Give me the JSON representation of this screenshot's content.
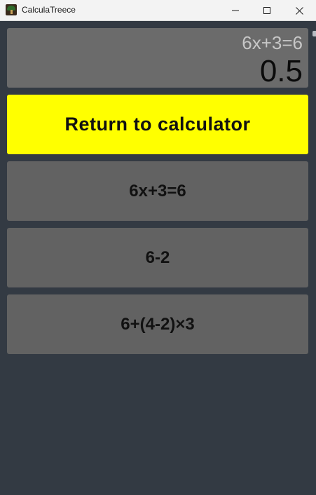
{
  "window": {
    "title": "CalculaTreece",
    "icon": "tree-app-icon",
    "controls": [
      "minimize-icon",
      "maximize-icon",
      "close-icon"
    ]
  },
  "display": {
    "expression": "6x+3=6",
    "result": "0.5"
  },
  "actions": {
    "return_label": "Return to calculator"
  },
  "history": [
    {
      "expression": "6x+3=6"
    },
    {
      "expression": "6-2"
    },
    {
      "expression": "6+(4-2)×3"
    }
  ],
  "colors": {
    "background": "#333a43",
    "display": "#6b6b6b",
    "return_button": "#ffff00",
    "history_button": "#626262",
    "titlebar": "#f3f3f3"
  }
}
